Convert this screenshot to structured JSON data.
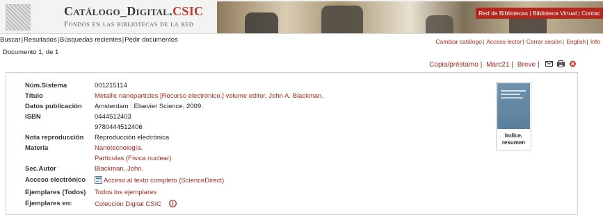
{
  "header": {
    "title_main": "Catálogo_Digital.",
    "title_accent": "CSIC",
    "subtitle": "Fondos en las bibliotecas de la red",
    "top_links": [
      "Red de Bibliotecas",
      "Biblioteca Virtual",
      "Contac"
    ]
  },
  "nav": {
    "left": [
      "Buscar",
      "Resultados",
      "Búsquedas recientes",
      "Pedir documentos"
    ],
    "right": [
      "Cambiar catálogo",
      "Acceso lector",
      "Cerrar sesión",
      "English",
      "Info"
    ]
  },
  "document_info": "Documento 1, de 1",
  "record_nav": {
    "links": [
      "Copia/préstamo",
      "Marc21",
      "Breve"
    ],
    "icons": [
      "email-icon",
      "print-icon",
      "close-icon"
    ]
  },
  "record": [
    {
      "label": "Núm.Sistema",
      "value": "001215114",
      "link": false
    },
    {
      "label": "Título",
      "value": "Metallic nanoparticles [Recurso electrónico.] volume editor, John A. Blackman.",
      "link": true
    },
    {
      "label": "Datos publicación",
      "value": "Amsterdam : Elsevier Science, 2009.",
      "link": false
    },
    {
      "label": "ISBN",
      "value": "0444512403",
      "link": false
    },
    {
      "label": "",
      "value": "9780444512406",
      "link": false
    },
    {
      "label": "Nota reproducción",
      "value": "Reproducción electrónica",
      "link": false
    },
    {
      "label": "Materia",
      "value": "Nanotecnología.",
      "link": true
    },
    {
      "label": "",
      "value": "Partículas (Física nuclear)",
      "link": true
    },
    {
      "label": "Sec.Autor",
      "value": "Blackman, John.",
      "link": true
    },
    {
      "label": "Acceso electrónico",
      "value": "Acceso al texto completo (ScienceDirect)",
      "link": true
    },
    {
      "label": "Ejemplares (Todos)",
      "value": "Todos los ejemplares",
      "link": true
    },
    {
      "label": "Ejemplares en:",
      "value": "Colección Digital CSIC",
      "link": true
    }
  ],
  "cover": {
    "caption": "Indice, resumen"
  },
  "colors": {
    "accent": "#b3261e",
    "header_bg": "#f3f3f1"
  }
}
